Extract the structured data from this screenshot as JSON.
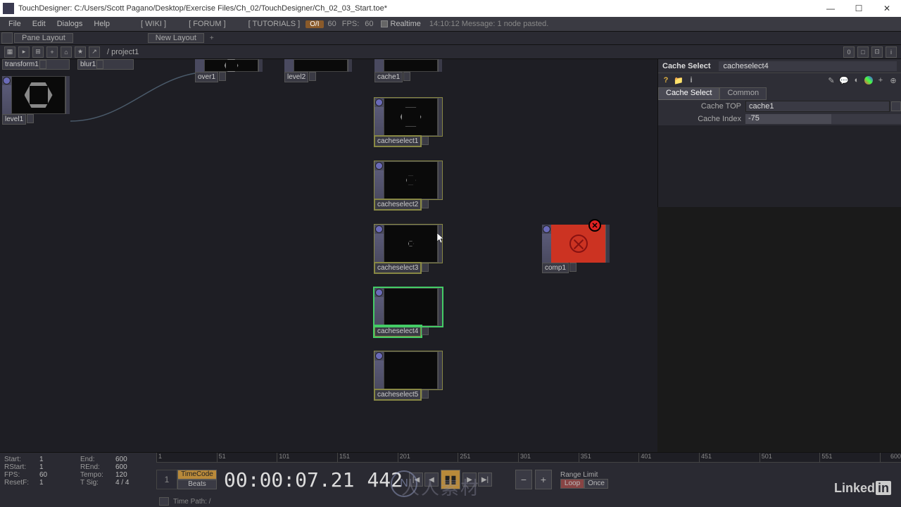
{
  "title": "TouchDesigner: C:/Users/Scott Pagano/Desktop/Exercise Files/Ch_02/TouchDesigner/Ch_02_03_Start.toe*",
  "menu": {
    "file": "File",
    "edit": "Edit",
    "dialogs": "Dialogs",
    "help": "Help",
    "wiki": "[ WIKI ]",
    "forum": "[ FORUM ]",
    "tutorials": "[ TUTORIALS ]",
    "opt_toggle": "O/I",
    "sixty": "60",
    "fps_label": "FPS:",
    "fps_value": "60",
    "realtime": "Realtime",
    "message": "14:10:12 Message: 1 node pasted."
  },
  "pane": {
    "layout": "Pane Layout",
    "newlayout": "New Layout"
  },
  "path": "/ project1",
  "nodes": {
    "transform1": "transform1",
    "blur1": "blur1",
    "level1": "level1",
    "over1": "over1",
    "level2": "level2",
    "cache1": "cache1",
    "cacheselect1": "cacheselect1",
    "cacheselect2": "cacheselect2",
    "cacheselect3": "cacheselect3",
    "cacheselect4": "cacheselect4",
    "cacheselect5": "cacheselect5",
    "comp1": "comp1"
  },
  "params": {
    "op_type": "Cache Select",
    "op_name": "cacheselect4",
    "tab1": "Cache Select",
    "tab2": "Common",
    "cache_top_label": "Cache TOP",
    "cache_top_value": "cache1",
    "cache_index_label": "Cache Index",
    "cache_index_value": "-75"
  },
  "timeline": {
    "start_l": "Start:",
    "start_v": "1",
    "end_l": "End:",
    "end_v": "600",
    "rstart_l": "RStart:",
    "rstart_v": "1",
    "rend_l": "REnd:",
    "rend_v": "600",
    "fps_l": "FPS:",
    "fps_v": "60",
    "tempo_l": "Tempo:",
    "tempo_v": "120",
    "resetf_l": "ResetF:",
    "resetf_v": "1",
    "tsig_l": "T Sig:",
    "tsig_v": "4 / 4",
    "timecode_btn": "TimeCode",
    "beats_btn": "Beats",
    "frame": "1",
    "tc": "00:00:07.21",
    "num": "442",
    "range_limit": "Range Limit",
    "loop": "Loop",
    "once": "Once",
    "ticks": [
      "1",
      "51",
      "101",
      "151",
      "201",
      "251",
      "301",
      "351",
      "401",
      "451",
      "501",
      "551",
      "600"
    ],
    "time_path": "Time Path: /"
  },
  "brand": {
    "linked": "Linked",
    "in": "in"
  },
  "watermark": "人人素材"
}
